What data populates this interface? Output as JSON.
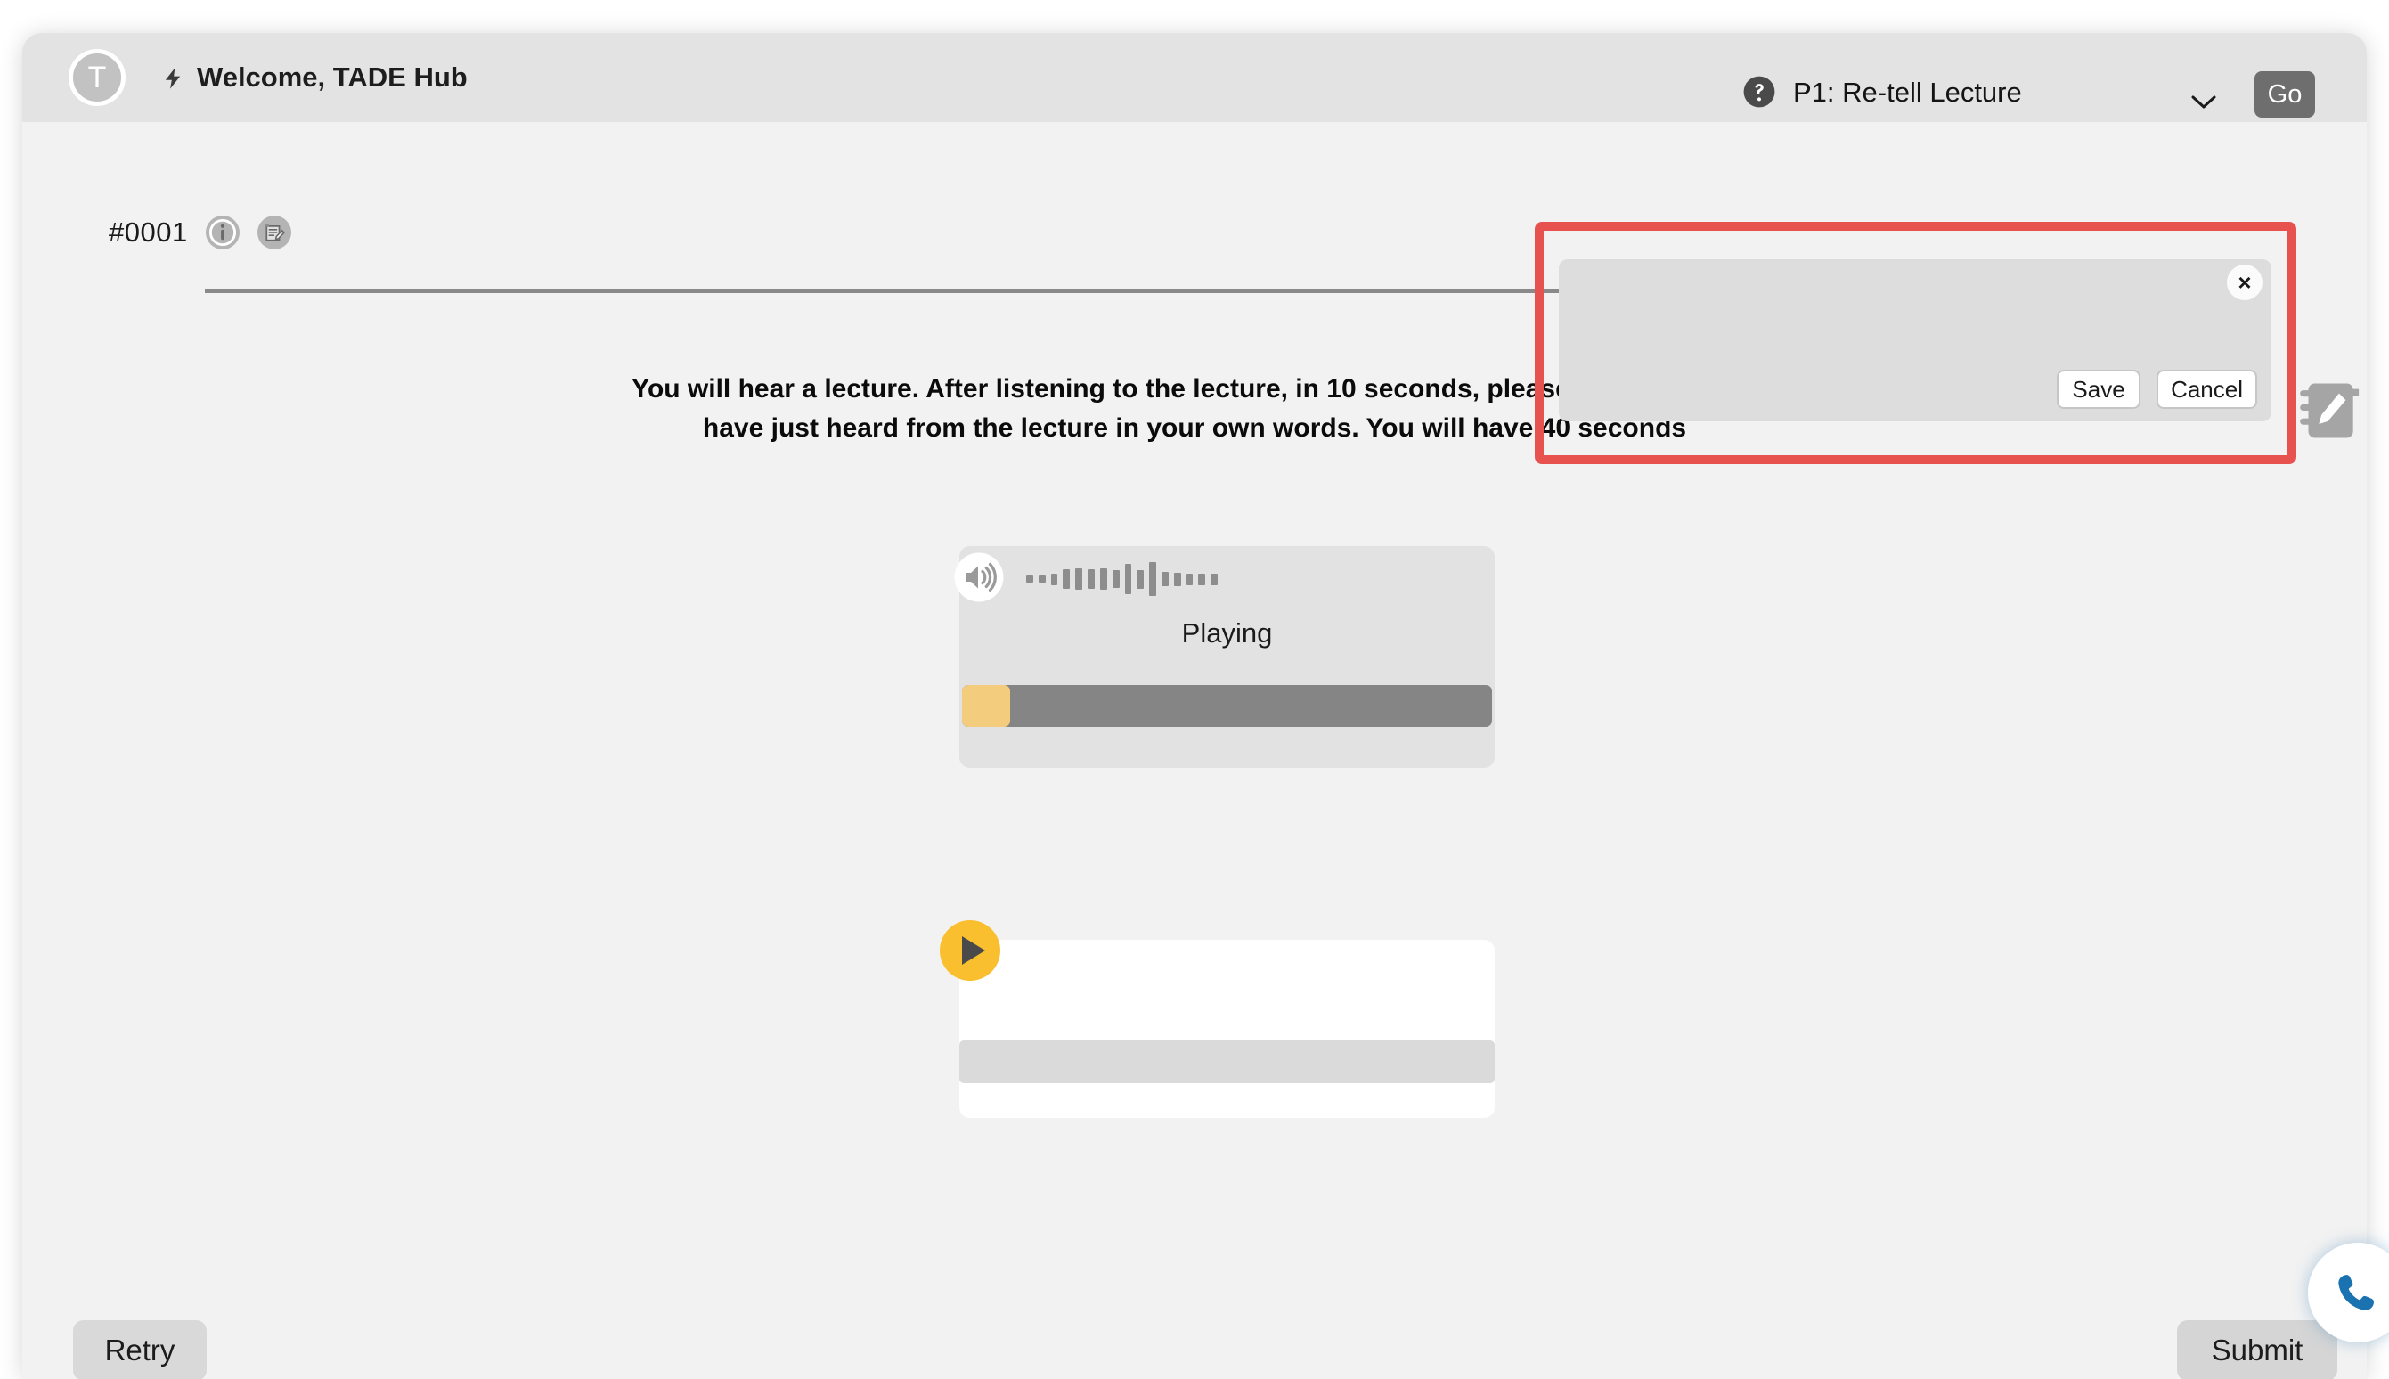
{
  "header": {
    "avatar_initial": "T",
    "bolt_icon": "bolt-icon",
    "welcome_text": "Welcome, TADE Hub",
    "help_icon": "help-circle-icon",
    "task_selected": "P1: Re-tell Lecture",
    "chevron_icon": "chevron-down-icon",
    "go_label": "Go"
  },
  "item": {
    "number": "#0001",
    "info_icon": "info-icon",
    "note_edit_icon": "note-edit-icon"
  },
  "instruction": {
    "line1": "You will hear a lecture. After listening to the lecture, in 10 seconds, please speak into the",
    "line2": "have just heard from the lecture in your own words. You will have 40 seconds",
    "full": "You will hear a lecture. After listening to the lecture, in 10 seconds, please speak into the microphone and retell what you have just heard from the lecture in your own words. You will have 40 seconds to give your response."
  },
  "audio_player": {
    "speaker_icon": "speaker-volume-icon",
    "status": "Playing",
    "progress_percent": 9,
    "waveform_heights": [
      8,
      8,
      13,
      22,
      24,
      22,
      24,
      20,
      34,
      21,
      38,
      16,
      15,
      13,
      13,
      13
    ],
    "progress_fill_color": "#f3cc7e",
    "progress_track_color": "#858585"
  },
  "recorder": {
    "play_icon": "play-icon",
    "play_button_color": "#f9bf2e",
    "level_bar_color": "#dadada"
  },
  "side_tools": {
    "note_icon": "notebook-edit-icon"
  },
  "note_panel": {
    "close_label": "×",
    "textarea_value": "",
    "save_label": "Save",
    "cancel_label": "Cancel",
    "highlight_color": "#e8524e"
  },
  "footer": {
    "retry_label": "Retry",
    "submit_label": "Submit"
  },
  "support": {
    "phone_icon": "phone-icon",
    "accent_color": "#1a72b0"
  }
}
